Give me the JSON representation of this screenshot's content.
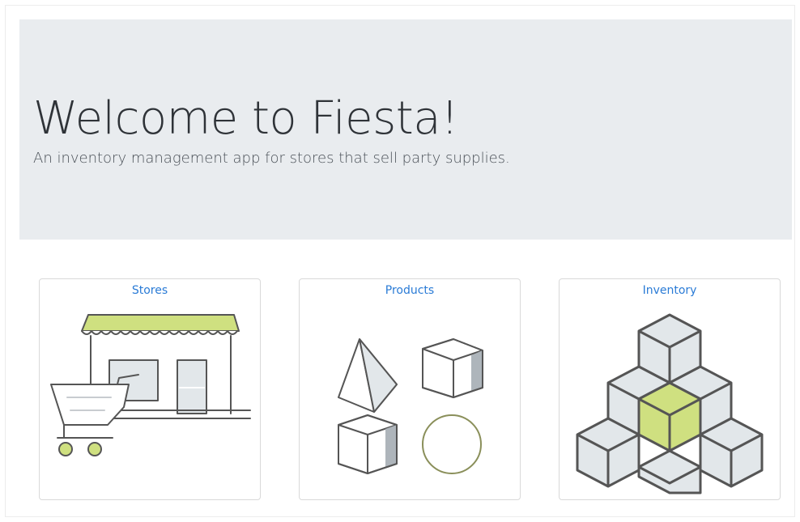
{
  "hero": {
    "title": "Welcome to Fiesta!",
    "lead": "An inventory management app for stores that sell party supplies."
  },
  "cards": [
    {
      "label": "Stores",
      "icon": "storefront-icon"
    },
    {
      "label": "Products",
      "icon": "shapes-icon"
    },
    {
      "label": "Inventory",
      "icon": "cube-stack-icon"
    }
  ],
  "colors": {
    "hero_bg": "#e9ecef",
    "link": "#2a7bd6",
    "accent_green": "#cfe080",
    "icon_stroke": "#555555",
    "icon_fill": "#e2e7ea"
  }
}
